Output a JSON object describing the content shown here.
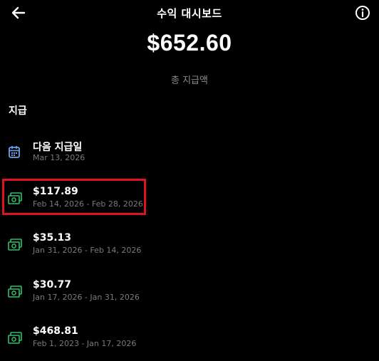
{
  "header": {
    "title": "수익 대시보드",
    "back_icon": "arrow-left-icon",
    "info_icon": "info-icon"
  },
  "summary": {
    "amount": "$652.60",
    "label": "총 지급액"
  },
  "payouts": {
    "section_title": "지급",
    "next": {
      "label": "다음 지급일",
      "date": "Mar 13, 2026",
      "icon": "calendar-icon"
    },
    "items": [
      {
        "amount": "$117.89",
        "period": "Feb 14, 2026 - Feb 28, 2026",
        "icon": "cash-icon"
      },
      {
        "amount": "$35.13",
        "period": "Jan 31, 2026 - Feb 14, 2026",
        "icon": "cash-icon"
      },
      {
        "amount": "$30.77",
        "period": "Jan 17, 2026 - Jan 31, 2026",
        "icon": "cash-icon"
      },
      {
        "amount": "$468.81",
        "period": "Feb 1, 2023 - Jan 17, 2026",
        "icon": "cash-icon"
      }
    ]
  },
  "colors": {
    "background": "#000000",
    "text": "#ffffff",
    "muted": "#7a7a7a",
    "calendar": "#6ea0e8",
    "cash": "#2ec06a",
    "highlight": "#e0141e"
  }
}
